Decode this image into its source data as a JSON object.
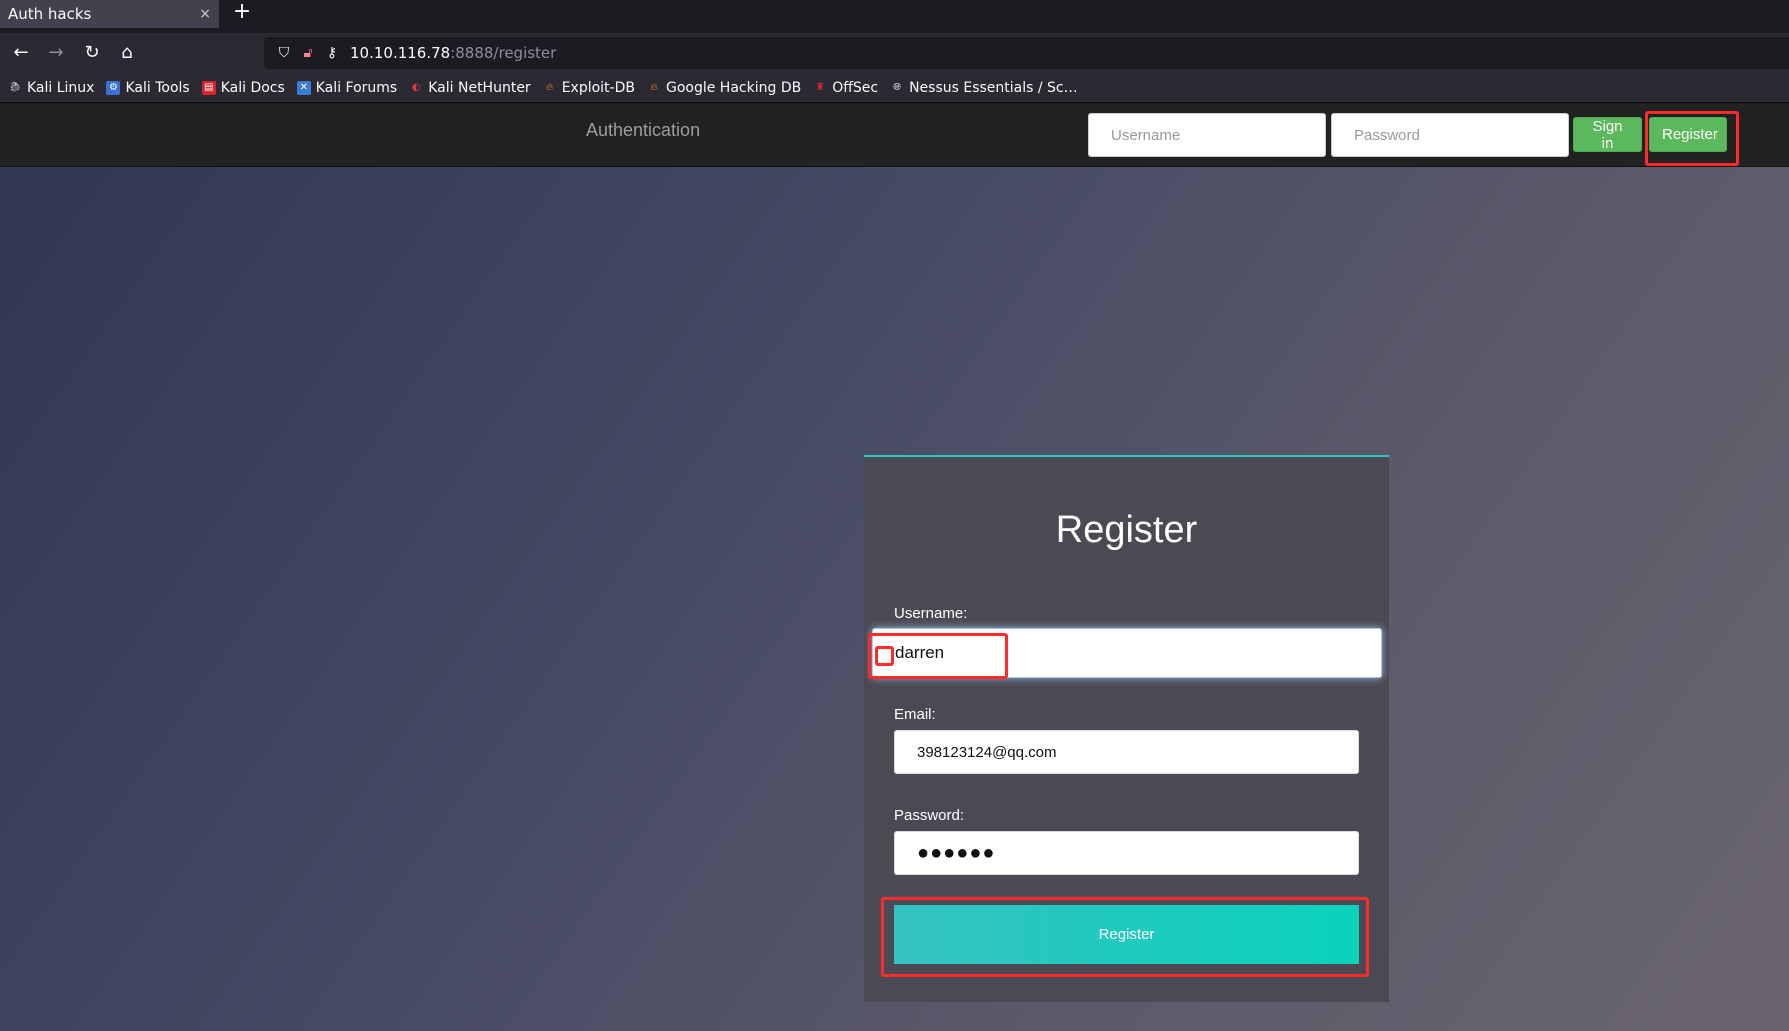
{
  "browser": {
    "tab_title": "Auth hacks",
    "tab_close": "×",
    "new_tab": "+",
    "url_host": "10.10.116.78",
    "url_path": ":8888/register",
    "bookmarks": [
      {
        "label": "Kali Linux",
        "icon": "kali-dragon-icon"
      },
      {
        "label": "Kali Tools",
        "icon": "kali-tools-icon"
      },
      {
        "label": "Kali Docs",
        "icon": "kali-docs-icon"
      },
      {
        "label": "Kali Forums",
        "icon": "kali-forums-icon"
      },
      {
        "label": "Kali NetHunter",
        "icon": "kali-nethunter-icon"
      },
      {
        "label": "Exploit-DB",
        "icon": "exploit-db-icon"
      },
      {
        "label": "Google Hacking DB",
        "icon": "ghdb-icon"
      },
      {
        "label": "OffSec",
        "icon": "offsec-icon"
      },
      {
        "label": "Nessus Essentials / Sc…",
        "icon": "globe-icon"
      }
    ]
  },
  "header": {
    "brand": "Authentication",
    "username_placeholder": "Username",
    "password_placeholder": "Password",
    "signin_label": "Sign in",
    "register_label": "Register"
  },
  "register_form": {
    "title": "Register",
    "username_label": "Username:",
    "username_value": "darren",
    "email_label": "Email:",
    "email_value": "398123124@qq.com",
    "password_label": "Password:",
    "password_value": "●●●●●●",
    "submit_label": "Register"
  },
  "colors": {
    "accent_teal": "#0ad3bb",
    "button_green": "#5cb85c",
    "highlight_red": "#ff2a2a"
  }
}
